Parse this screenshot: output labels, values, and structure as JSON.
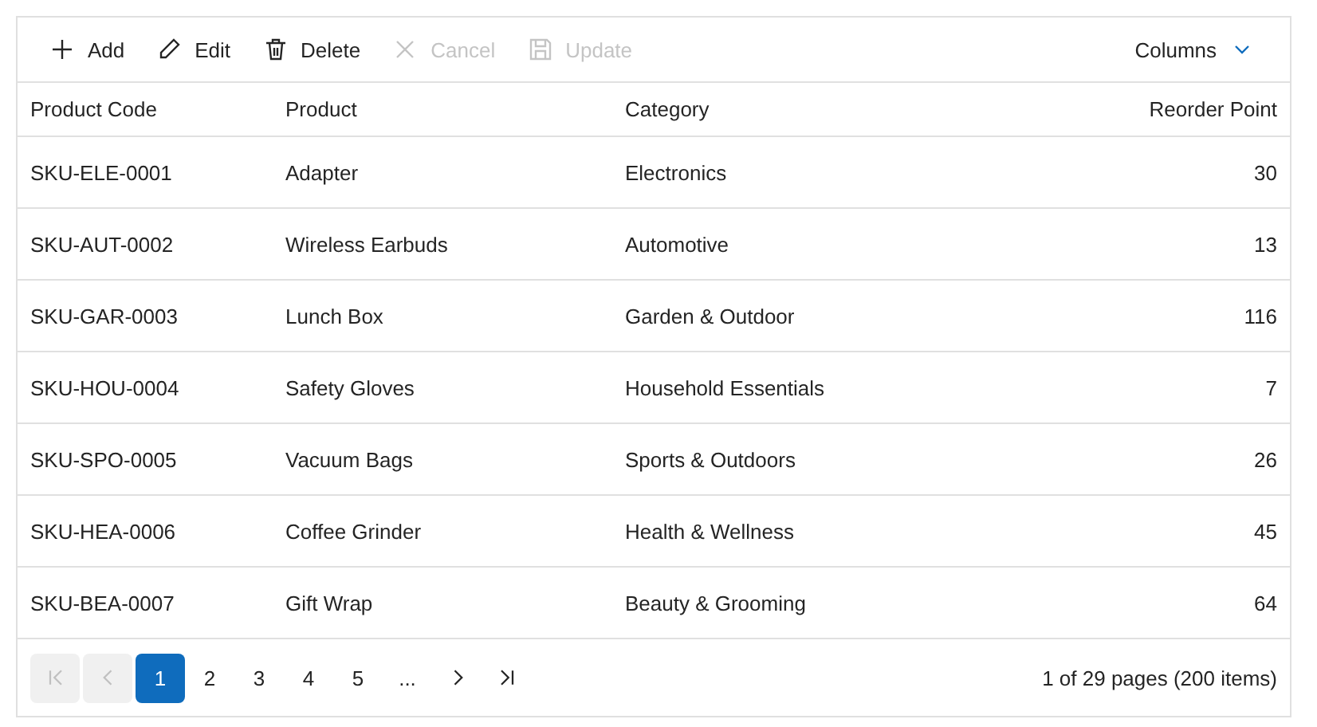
{
  "toolbar": {
    "items": [
      {
        "kind": "add",
        "label": "Add",
        "disabled": false
      },
      {
        "kind": "edit",
        "label": "Edit",
        "disabled": false
      },
      {
        "kind": "delete",
        "label": "Delete",
        "disabled": false
      },
      {
        "kind": "cancel",
        "label": "Cancel",
        "disabled": true
      },
      {
        "kind": "update",
        "label": "Update",
        "disabled": true
      }
    ],
    "columns_button": {
      "label": "Columns"
    }
  },
  "table": {
    "columns": [
      {
        "label": "Product Code",
        "numeric": false
      },
      {
        "label": "Product",
        "numeric": false
      },
      {
        "label": "Category",
        "numeric": false
      },
      {
        "label": "Reorder Point",
        "numeric": true
      }
    ],
    "rows": [
      [
        "SKU-ELE-0001",
        "Adapter",
        "Electronics",
        "30"
      ],
      [
        "SKU-AUT-0002",
        "Wireless Earbuds",
        "Automotive",
        "13"
      ],
      [
        "SKU-GAR-0003",
        "Lunch Box",
        "Garden & Outdoor",
        "116"
      ],
      [
        "SKU-HOU-0004",
        "Safety Gloves",
        "Household Essentials",
        "7"
      ],
      [
        "SKU-SPO-0005",
        "Vacuum Bags",
        "Sports & Outdoors",
        "26"
      ],
      [
        "SKU-HEA-0006",
        "Coffee Grinder",
        "Health & Wellness",
        "45"
      ],
      [
        "SKU-BEA-0007",
        "Gift Wrap",
        "Beauty & Grooming",
        "64"
      ]
    ]
  },
  "pager": {
    "items": [
      {
        "kind": "first",
        "disabled": true
      },
      {
        "kind": "prev",
        "disabled": true
      },
      {
        "kind": "page",
        "label": "1",
        "selected": true
      },
      {
        "kind": "page",
        "label": "2",
        "selected": false
      },
      {
        "kind": "page",
        "label": "3",
        "selected": false
      },
      {
        "kind": "page",
        "label": "4",
        "selected": false
      },
      {
        "kind": "page",
        "label": "5",
        "selected": false
      },
      {
        "kind": "ellipsis",
        "label": "..."
      },
      {
        "kind": "next",
        "disabled": false
      },
      {
        "kind": "last",
        "disabled": false
      }
    ],
    "info": "1 of 29 pages (200 items)"
  }
}
